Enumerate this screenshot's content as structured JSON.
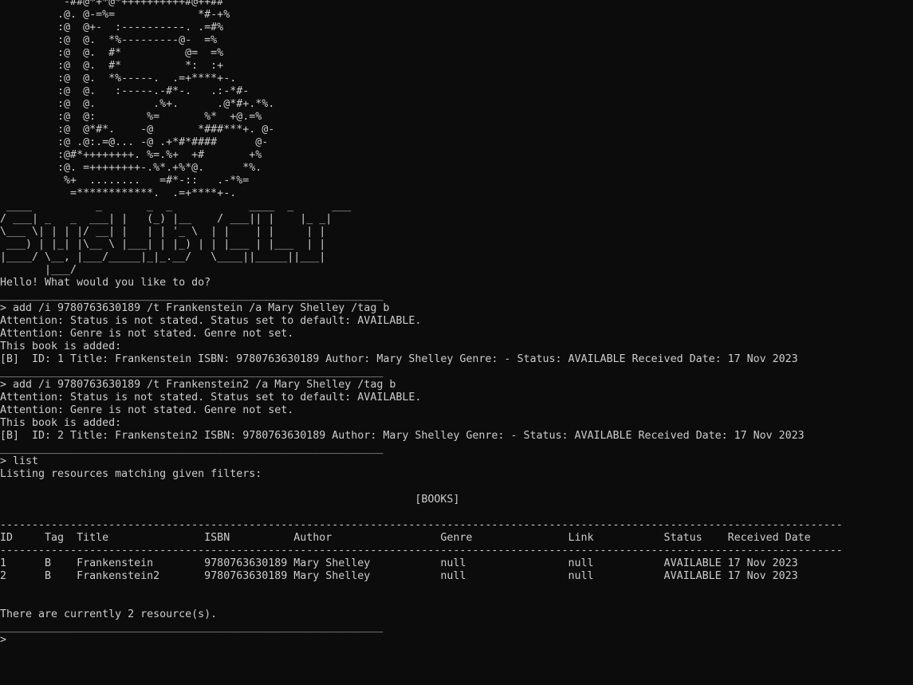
{
  "banner": {
    "lines": [
      "          -##@*+*@*++++++++++#@++##",
      "         .@. @-=%=             *#-+%",
      "         :@  @+-  :----------. .=#%",
      "         :@  @.  *%---------@-  =%",
      "         :@  @.  #*          @=  =%",
      "         :@  @.  #*          *:  :+",
      "         :@  @.  *%-----.  .=+****+-.",
      "         :@  @.   :-----.-#*-.   .:-*#-",
      "         :@  @.         .%+.      .@*#+.*%.",
      "         :@  @:        %=       %*  +@.=%",
      "         :@  @*#*.    -@       *###***+. @-",
      "         :@ .@:.=@... -@ .+*#*####      @-",
      "         :@#*++++++++. %=.%+  +#       +%",
      "         :@. =++++++++-.%*.+%*@.      *%.",
      "          %+  ........   =#*-::   .-*%=",
      "           =************.  .=+****+-.",
      " ____          _       _  _            ____  _      ___ ",
      "/ ___| _   _  ___| |   (_) |__    / ___|| |    |_ _|",
      "\\___ \\| | | |/ __| |   | | '_ \\  | |    | |     | | ",
      " ___) | |_| |\\__ \\ |___| | |_) | | |___ | |___  | | ",
      "|____/ \\__, |___/_____|_|_.__/   \\____||_____||___|",
      "       |___/"
    ]
  },
  "session": {
    "greeting": "Hello! What would you like to do?",
    "divider": "____________________________________________________________",
    "commands": [
      {
        "input": "> add /i 9780763630189 /t Frankenstein /a Mary Shelley /tag b",
        "output": [
          "Attention: Status is not stated. Status set to default: AVAILABLE.",
          "Attention: Genre is not stated. Genre not set.",
          "This book is added:",
          "[B]  ID: 1 Title: Frankenstein ISBN: 9780763630189 Author: Mary Shelley Genre: - Status: AVAILABLE Received Date: 17 Nov 2023"
        ]
      },
      {
        "input": "> add /i 9780763630189 /t Frankenstein2 /a Mary Shelley /tag b",
        "output": [
          "Attention: Status is not stated. Status set to default: AVAILABLE.",
          "Attention: Genre is not stated. Genre not set.",
          "This book is added:",
          "[B]  ID: 2 Title: Frankenstein2 ISBN: 9780763630189 Author: Mary Shelley Genre: - Status: AVAILABLE Received Date: 17 Nov 2023"
        ]
      }
    ],
    "list_command": {
      "input": "> list",
      "header": "Listing resources matching given filters:",
      "section_title": "                                                                 [BOOKS]",
      "rule": "------------------------------------------------------------------------------------------------------------------------------------",
      "table_header": "ID     Tag  Title               ISBN          Author                 Genre               Link           Status    Received Date",
      "rows": [
        "1      B    Frankenstein        9780763630189 Mary Shelley           null                null           AVAILABLE 17 Nov 2023",
        "2      B    Frankenstein2       9780763630189 Mary Shelley           null                null           AVAILABLE 17 Nov 2023"
      ],
      "summary": "There are currently 2 resource(s)."
    },
    "prompt": ">"
  }
}
